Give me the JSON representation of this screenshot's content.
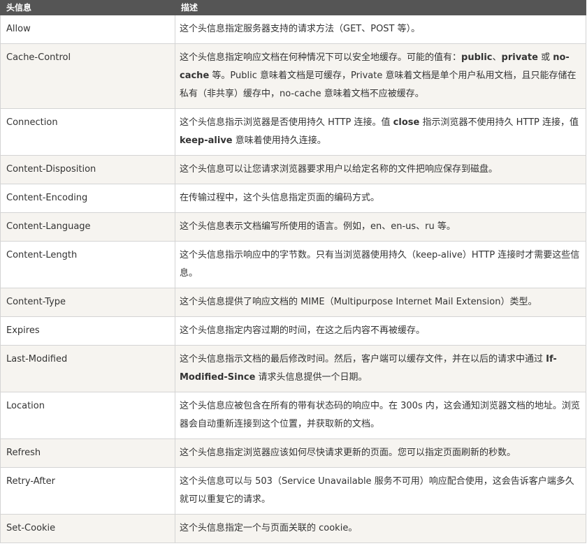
{
  "table": {
    "headers": [
      "头信息",
      "描述"
    ],
    "rows": [
      {
        "name": "Allow",
        "desc": [
          {
            "t": "这个头信息指定服务器支持的请求方法（GET、POST 等）。"
          }
        ]
      },
      {
        "name": "Cache-Control",
        "desc": [
          {
            "t": "这个头信息指定响应文档在何种情况下可以安全地缓存。可能的值有："
          },
          {
            "t": "public",
            "b": true
          },
          {
            "t": "、"
          },
          {
            "t": "private",
            "b": true
          },
          {
            "t": " 或 "
          },
          {
            "t": "no-cache",
            "b": true
          },
          {
            "t": " 等。Public 意味着文档是可缓存，Private 意味着文档是单个用户私用文档，且只能存储在私有（非共享）缓存中，no-cache 意味着文档不应被缓存。"
          }
        ]
      },
      {
        "name": "Connection",
        "desc": [
          {
            "t": "这个头信息指示浏览器是否使用持久 HTTP 连接。值 "
          },
          {
            "t": "close",
            "b": true
          },
          {
            "t": " 指示浏览器不使用持久 HTTP 连接，值 "
          },
          {
            "t": "keep-alive",
            "b": true
          },
          {
            "t": " 意味着使用持久连接。"
          }
        ]
      },
      {
        "name": "Content-Disposition",
        "desc": [
          {
            "t": "这个头信息可以让您请求浏览器要求用户以给定名称的文件把响应保存到磁盘。"
          }
        ]
      },
      {
        "name": "Content-Encoding",
        "desc": [
          {
            "t": "在传输过程中，这个头信息指定页面的编码方式。"
          }
        ]
      },
      {
        "name": "Content-Language",
        "desc": [
          {
            "t": "这个头信息表示文档编写所使用的语言。例如，en、en-us、ru 等。"
          }
        ]
      },
      {
        "name": "Content-Length",
        "desc": [
          {
            "t": "这个头信息指示响应中的字节数。只有当浏览器使用持久（keep-alive）HTTP 连接时才需要这些信息。"
          }
        ]
      },
      {
        "name": "Content-Type",
        "desc": [
          {
            "t": "这个头信息提供了响应文档的 MIME（Multipurpose Internet Mail Extension）类型。"
          }
        ]
      },
      {
        "name": "Expires",
        "desc": [
          {
            "t": "这个头信息指定内容过期的时间，在这之后内容不再被缓存。"
          }
        ]
      },
      {
        "name": "Last-Modified",
        "desc": [
          {
            "t": "这个头信息指示文档的最后修改时间。然后，客户端可以缓存文件，并在以后的请求中通过 "
          },
          {
            "t": "If-Modified-Since",
            "b": true
          },
          {
            "t": " 请求头信息提供一个日期。"
          }
        ]
      },
      {
        "name": "Location",
        "desc": [
          {
            "t": "这个头信息应被包含在所有的带有状态码的响应中。在 300s 内，这会通知浏览器文档的地址。浏览器会自动重新连接到这个位置，并获取新的文档。"
          }
        ]
      },
      {
        "name": "Refresh",
        "desc": [
          {
            "t": "这个头信息指定浏览器应该如何尽快请求更新的页面。您可以指定页面刷新的秒数。"
          }
        ]
      },
      {
        "name": "Retry-After",
        "desc": [
          {
            "t": "这个头信息可以与 503（Service Unavailable 服务不可用）响应配合使用，这会告诉客户端多久就可以重复它的请求。"
          }
        ]
      },
      {
        "name": "Set-Cookie",
        "desc": [
          {
            "t": "这个头信息指定一个与页面关联的 cookie。"
          }
        ]
      }
    ]
  }
}
